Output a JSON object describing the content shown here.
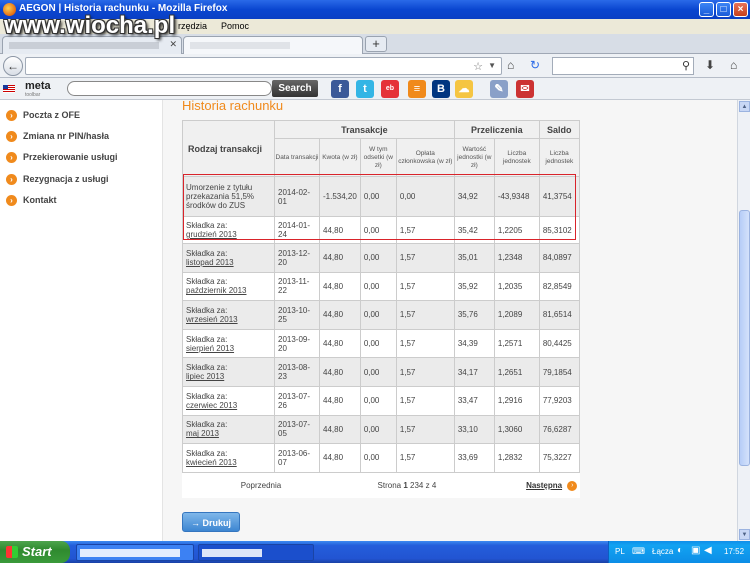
{
  "window": {
    "title": "AEGON | Historia rachunku - Mozilla Firefox",
    "buttons": [
      "_",
      "□",
      "×"
    ]
  },
  "watermark": "www.wiocha.pl",
  "menubar": {
    "items": [
      "Pli",
      "rzędzia",
      "Pomoc"
    ]
  },
  "tabs": {
    "new_tab": "+"
  },
  "toolbar": {
    "meta_label": "meta",
    "meta_sub": "toolbar",
    "search_button": "Search"
  },
  "sidebar": {
    "items": [
      {
        "label": "Poczta z OFE"
      },
      {
        "label": "Zmiana nr PIN/hasła"
      },
      {
        "label": "Przekierowanie usługi"
      },
      {
        "label": "Rezygnacja z usługi"
      },
      {
        "label": "Kontakt"
      }
    ]
  },
  "page": {
    "title": "Historia rachunku",
    "table": {
      "groups": {
        "rodzaj": "Rodzaj transakcji",
        "transakcje": "Transakcje",
        "przeliczenia": "Przeliczenia",
        "saldo": "Saldo"
      },
      "columns": [
        "Data transakcji",
        "Kwota (w zł)",
        "W tym odsetki (w zł)",
        "Opłata członkowska (w zł)",
        "Wartość jednostki (w zł)",
        "Liczba jednostek",
        "Liczba jednostek"
      ],
      "rows": [
        {
          "type_prefix": "Umorzenie z tytułu przekazania 51,5% środków do ZUS",
          "type_link": "",
          "date": "2014-02-01",
          "amount": "-1.534,20",
          "interest": "0,00",
          "fee": "0,00",
          "unit_value": "34,92",
          "units": "-43,9348",
          "balance": "41,3754"
        },
        {
          "type_prefix": "Składka za:",
          "type_link": "grudzień 2013",
          "date": "2014-01-24",
          "amount": "44,80",
          "interest": "0,00",
          "fee": "1,57",
          "unit_value": "35,42",
          "units": "1,2205",
          "balance": "85,3102"
        },
        {
          "type_prefix": "Składka za:",
          "type_link": "listopad 2013",
          "date": "2013-12-20",
          "amount": "44,80",
          "interest": "0,00",
          "fee": "1,57",
          "unit_value": "35,01",
          "units": "1,2348",
          "balance": "84,0897"
        },
        {
          "type_prefix": "Składka za:",
          "type_link": "październik 2013",
          "date": "2013-11-22",
          "amount": "44,80",
          "interest": "0,00",
          "fee": "1,57",
          "unit_value": "35,92",
          "units": "1,2035",
          "balance": "82,8549"
        },
        {
          "type_prefix": "Składka za:",
          "type_link": "wrzesień 2013",
          "date": "2013-10-25",
          "amount": "44,80",
          "interest": "0,00",
          "fee": "1,57",
          "unit_value": "35,76",
          "units": "1,2089",
          "balance": "81,6514"
        },
        {
          "type_prefix": "Składka za:",
          "type_link": "sierpień 2013",
          "date": "2013-09-20",
          "amount": "44,80",
          "interest": "0,00",
          "fee": "1,57",
          "unit_value": "34,39",
          "units": "1,2571",
          "balance": "80,4425"
        },
        {
          "type_prefix": "Składka za:",
          "type_link": "lipiec 2013",
          "date": "2013-08-23",
          "amount": "44,80",
          "interest": "0,00",
          "fee": "1,57",
          "unit_value": "34,17",
          "units": "1,2651",
          "balance": "79,1854"
        },
        {
          "type_prefix": "Składka za:",
          "type_link": "czerwiec 2013",
          "date": "2013-07-26",
          "amount": "44,80",
          "interest": "0,00",
          "fee": "1,57",
          "unit_value": "33,47",
          "units": "1,2916",
          "balance": "77,9203"
        },
        {
          "type_prefix": "Składka za:",
          "type_link": "maj 2013",
          "date": "2013-07-05",
          "amount": "44,80",
          "interest": "0,00",
          "fee": "1,57",
          "unit_value": "33,10",
          "units": "1,3060",
          "balance": "76,6287"
        },
        {
          "type_prefix": "Składka za:",
          "type_link": "kwiecień 2013",
          "date": "2013-06-07",
          "amount": "44,80",
          "interest": "0,00",
          "fee": "1,57",
          "unit_value": "33,69",
          "units": "1,2832",
          "balance": "75,3227"
        }
      ],
      "pagination": {
        "prev": "Poprzednia",
        "strona": "Strona",
        "current": "1",
        "pages": [
          "2",
          "3",
          "4"
        ],
        "of": "z 4",
        "next": "Następna"
      }
    },
    "print_button": "Drukuj"
  },
  "taskbar": {
    "start": "Start",
    "lang": "PL",
    "network": "Łącza",
    "clock": "17:52"
  },
  "colors": {
    "accent": "#f08a1c",
    "highlight_border": "#d9232a",
    "title_bar": "#0a46d0"
  }
}
